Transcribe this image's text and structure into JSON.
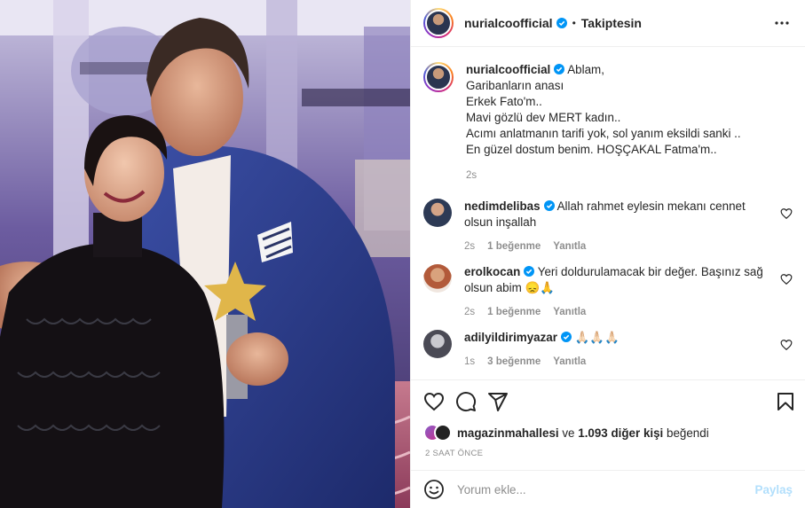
{
  "header": {
    "username": "nurialcoofficial",
    "separator": "•",
    "follow_label": "Takiptesin"
  },
  "caption": {
    "username": "nurialcoofficial",
    "text": "Ablam,\nGaribanların anası\nErkek Fato'm..\nMavi gözlü dev MERT kadın..\nAcımı anlatmanın tarifi yok, sol yanım eksildi sanki ..\nEn güzel dostum benim. HOŞÇAKAL Fatma'm..",
    "time": "2s"
  },
  "comments": [
    {
      "username": "nedimdelibas",
      "text": "Allah rahmet eylesin mekanı cennet olsun inşallah",
      "time": "2s",
      "likes": "1 beğenme",
      "reply": "Yanıtla"
    },
    {
      "username": "erolkocan",
      "text": "Yeri doldurulamacak bir değer. Başınız sağ olsun abim 😞🙏",
      "time": "2s",
      "likes": "1 beğenme",
      "reply": "Yanıtla"
    },
    {
      "username": "adilyildirimyazar",
      "text": "🙏🏻🙏🏻🙏🏻",
      "time": "1s",
      "likes": "3 beğenme",
      "reply": "Yanıtla"
    }
  ],
  "likes_line": {
    "first_user": "magazinmahallesi",
    "connector": "ve",
    "others": "1.093 diğer kişi",
    "suffix": "beğendi"
  },
  "posted_ago": "2 SAAT ÖNCE",
  "add_comment": {
    "placeholder": "Yorum ekle...",
    "post_label": "Paylaş"
  },
  "icons": {
    "verified": "verified-badge-icon",
    "more": "more-horizontal-icon",
    "like": "heart-icon",
    "comment": "comment-icon",
    "share": "share-paper-plane-icon",
    "save": "bookmark-icon",
    "emoji": "emoji-icon"
  },
  "colors": {
    "verified_blue": "#0095f6",
    "post_disabled": "#b2dffc",
    "secondary_text": "#8e8e8e"
  }
}
